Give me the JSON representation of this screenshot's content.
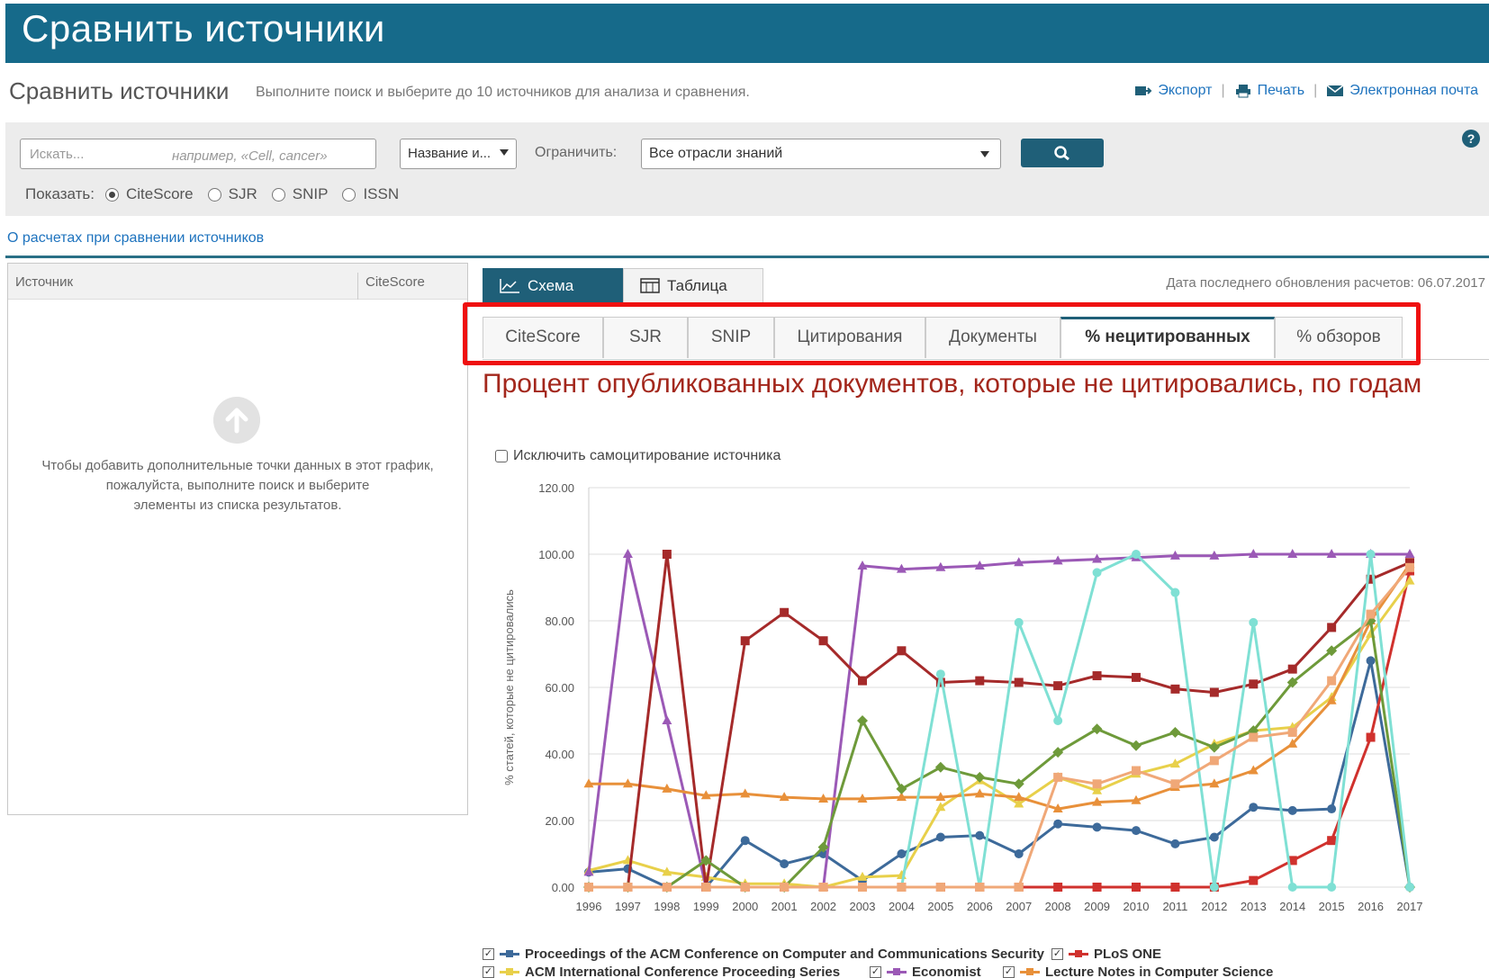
{
  "header": {
    "title": "Сравнить источники"
  },
  "subheader": {
    "title": "Сравнить источники",
    "description": "Выполните поиск и выберите до 10 источников для анализа и сравнения.",
    "actions": [
      {
        "label": "Экспорт",
        "icon": "export-icon"
      },
      {
        "label": "Печать",
        "icon": "print-icon"
      },
      {
        "label": "Электронная почта",
        "icon": "email-icon"
      }
    ]
  },
  "search": {
    "placeholder": "Искать...",
    "example": "например, «Cell, cancer»",
    "field_select": "Название и...",
    "limit_label": "Ограничить:",
    "limit_value": "Все отрасли знаний",
    "show_label": "Показать:",
    "show_options": [
      "CiteScore",
      "SJR",
      "SNIP",
      "ISSN"
    ],
    "show_selected": "CiteScore"
  },
  "about_link": "О расчетах при сравнении источников",
  "left_panel": {
    "col_source": "Источник",
    "col_metric": "CiteScore",
    "message_line1": "Чтобы добавить дополнительные точки данных в этот график,",
    "message_line2": "пожалуйста, выполните поиск и выберите",
    "message_line3": "элементы из списка результатов."
  },
  "view_tabs": [
    {
      "label": "Схема",
      "active": true
    },
    {
      "label": "Таблица",
      "active": false
    }
  ],
  "updated": "Дата последнего обновления расчетов: 06.07.2017",
  "metric_tabs": [
    {
      "label": "CiteScore",
      "active": false
    },
    {
      "label": "SJR",
      "active": false
    },
    {
      "label": "SNIP",
      "active": false
    },
    {
      "label": "Цитирования",
      "active": false
    },
    {
      "label": "Документы",
      "active": false
    },
    {
      "label": "% нецитированных",
      "active": true
    },
    {
      "label": "% обзоров",
      "active": false
    }
  ],
  "chart_title": "Процент опубликованных документов, которые не цитировались, по годам",
  "exclude_self": "Исключить самоцитирование источника",
  "colors": {
    "brand": "#166a8a",
    "button": "#1f5f78",
    "title": "#a3271c",
    "highlight": "#ef1010"
  },
  "chart_data": {
    "type": "line",
    "title": "Процент опубликованных документов, которые не цитировались, по годам",
    "xlabel": "",
    "ylabel": "% статей, которые не цитировались",
    "ylim": [
      0,
      120
    ],
    "yticks": [
      "0.00",
      "20.00",
      "40.00",
      "60.00",
      "80.00",
      "100.00",
      "120.00"
    ],
    "x": [
      "1996",
      "1997",
      "1998",
      "1999",
      "2000",
      "2001",
      "2002",
      "2003",
      "2004",
      "2005",
      "2006",
      "2007",
      "2008",
      "2009",
      "2010",
      "2011",
      "2012",
      "2013",
      "2014",
      "2015",
      "2016",
      "2017"
    ],
    "grid": true,
    "legend_position": "bottom",
    "series": [
      {
        "name": "Proceedings of the ACM Conference on Computer and Communications Security",
        "color": "#3d6a9a",
        "marker": "circle",
        "values": [
          4.5,
          5.5,
          0,
          0,
          14,
          7,
          10,
          2,
          10,
          15,
          15.5,
          10,
          19,
          18,
          17,
          13,
          15,
          24,
          23,
          23.5,
          68,
          0
        ]
      },
      {
        "name": "PLoS ONE",
        "color": "#d0312d",
        "marker": "square",
        "values": [
          0,
          0,
          0,
          0,
          0,
          0,
          0,
          0,
          0,
          0,
          0,
          0,
          0,
          0,
          0,
          0,
          0,
          2,
          8,
          14,
          45,
          95
        ]
      },
      {
        "name": "ACM International Conference Proceeding Series",
        "color": "#e8d04a",
        "marker": "triangle",
        "values": [
          5,
          8,
          4.5,
          3,
          1,
          1,
          0,
          3,
          3.5,
          24,
          32,
          25,
          33,
          29,
          34,
          37,
          43,
          47,
          48,
          57,
          76,
          92
        ]
      },
      {
        "name": "Economist",
        "color": "#9b59b6",
        "marker": "triangle",
        "values": [
          4.5,
          100,
          50,
          0,
          0,
          0,
          0,
          96.5,
          95.5,
          96,
          96.5,
          97.5,
          98,
          98.5,
          99,
          99.5,
          99.5,
          100,
          100,
          100,
          100,
          100
        ]
      },
      {
        "name": "Lecture Notes in Computer Science",
        "color": "#e8903a",
        "marker": "triangle",
        "values": [
          31,
          31,
          29.5,
          27.5,
          28,
          27,
          26.5,
          26.5,
          27,
          27,
          28,
          27,
          23.5,
          25.5,
          26,
          30,
          31,
          35,
          43,
          56,
          80,
          97
        ]
      },
      {
        "name": "",
        "color": "#a52a2a",
        "marker": "square",
        "values": [
          0,
          0,
          100,
          0,
          74,
          82.5,
          74,
          62,
          71,
          61.5,
          62,
          61.5,
          60.5,
          63.5,
          63,
          59.5,
          58.5,
          61,
          65.5,
          78,
          92.5,
          97.5
        ]
      },
      {
        "name": "",
        "color": "#6e9a3a",
        "marker": "diamond",
        "values": [
          0,
          0,
          0,
          8,
          0,
          0,
          12,
          50,
          29.5,
          36,
          33,
          31,
          40.5,
          47.5,
          42.5,
          46.5,
          42,
          47,
          61.5,
          71,
          80,
          0
        ]
      },
      {
        "name": "",
        "color": "#7fe0d4",
        "marker": "circle",
        "values": [
          0,
          0,
          0,
          0,
          0,
          0,
          0,
          0,
          0,
          64,
          0,
          79.5,
          50,
          94.5,
          100,
          88.5,
          0,
          79.5,
          0,
          0,
          100,
          0
        ]
      },
      {
        "name": "",
        "color": "#f0a878",
        "marker": "square",
        "values": [
          0,
          0,
          0,
          0,
          0,
          0,
          0,
          0,
          0,
          0,
          0,
          0,
          33,
          31,
          35,
          31,
          38,
          45,
          46.5,
          62,
          82,
          96
        ]
      }
    ]
  },
  "legend": [
    {
      "name": "Proceedings of the ACM Conference on Computer and Communications Security",
      "color": "#3d6a9a"
    },
    {
      "name": "PLoS ONE",
      "color": "#d0312d"
    },
    {
      "name": "ACM International Conference Proceeding Series",
      "color": "#e8d04a"
    },
    {
      "name": "Economist",
      "color": "#9b59b6"
    },
    {
      "name": "Lecture Notes in Computer Science",
      "color": "#e8903a"
    }
  ]
}
